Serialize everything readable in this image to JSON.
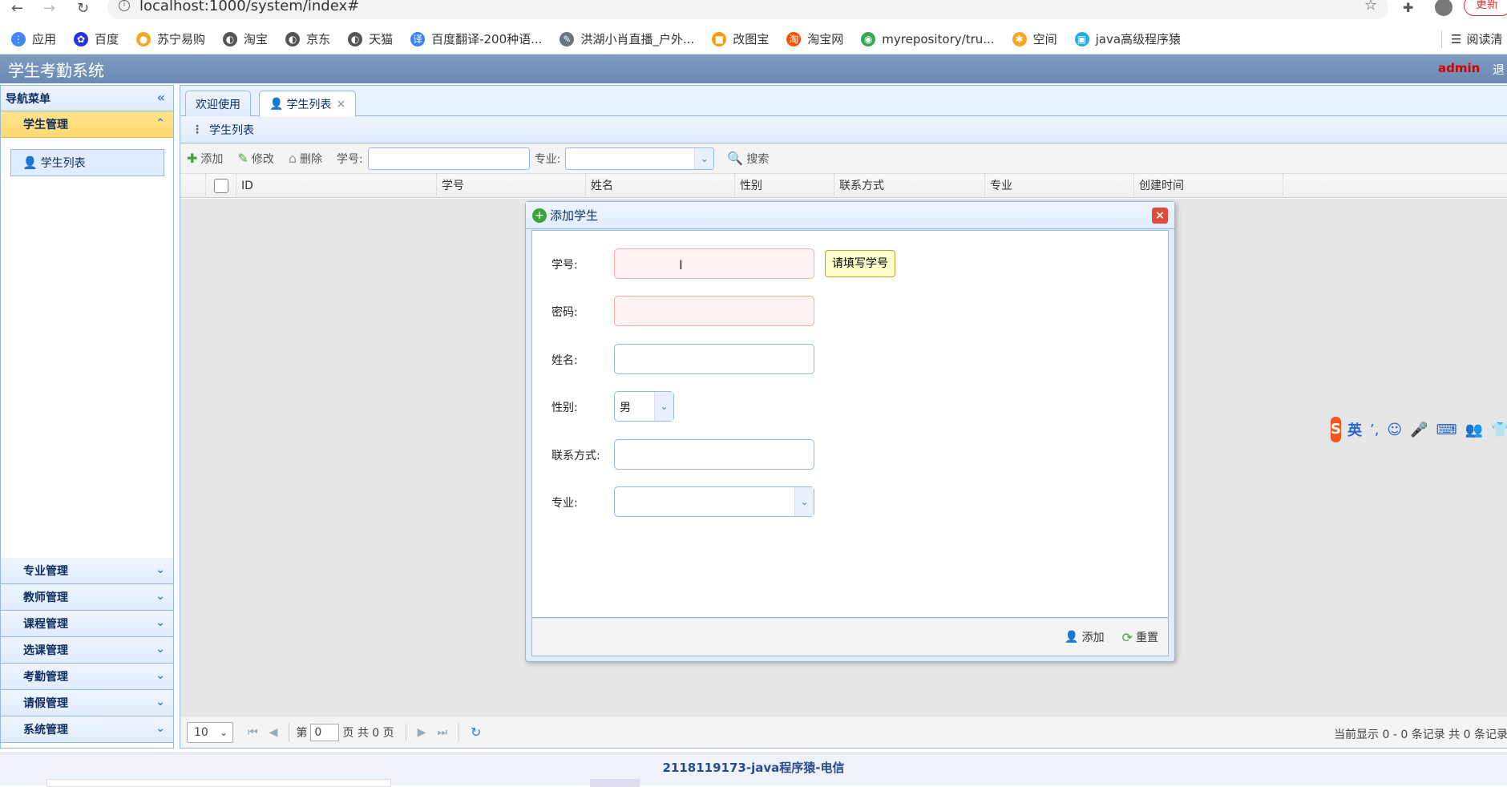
{
  "browser": {
    "url": "localhost:1000/system/index#",
    "update_label": "更新",
    "reading_mode": "阅读清",
    "bookmarks": [
      {
        "label": "应用",
        "icon": "apps-icon",
        "color": "#4285f4"
      },
      {
        "label": "百度",
        "icon": "baidu-icon",
        "color": "#2932e1"
      },
      {
        "label": "苏宁易购",
        "icon": "suning-icon",
        "color": "#f5a623"
      },
      {
        "label": "淘宝",
        "icon": "globe-icon",
        "color": "#555555"
      },
      {
        "label": "京东",
        "icon": "globe-icon",
        "color": "#555555"
      },
      {
        "label": "天猫",
        "icon": "globe-icon",
        "color": "#555555"
      },
      {
        "label": "百度翻译-200种语...",
        "icon": "translate-icon",
        "color": "#3b82f6"
      },
      {
        "label": "洪湖小肖直播_户外...",
        "icon": "feather-icon",
        "color": "#6b7280"
      },
      {
        "label": "改图宝",
        "icon": "gaitubao-icon",
        "color": "#f59e0b"
      },
      {
        "label": "淘宝网",
        "icon": "taobao-icon",
        "color": "#ff5000"
      },
      {
        "label": "myrepository/tru...",
        "icon": "chrome-icon",
        "color": "#34a853"
      },
      {
        "label": "空间",
        "icon": "qzone-icon",
        "color": "#f5a623"
      },
      {
        "label": "java高级程序猿",
        "icon": "bilibili-icon",
        "color": "#23ade5"
      }
    ]
  },
  "app": {
    "title": "学生考勤系统",
    "user": "admin",
    "logout": "退"
  },
  "nav": {
    "header": "导航菜单",
    "active_group": "学生管理",
    "active_item": "学生列表",
    "groups": [
      "专业管理",
      "教师管理",
      "课程管理",
      "选课管理",
      "考勤管理",
      "请假管理",
      "系统管理"
    ]
  },
  "tabs": [
    {
      "label": "欢迎使用"
    },
    {
      "label": "学生列表",
      "close": "×"
    }
  ],
  "panel": {
    "title": "学生列表"
  },
  "toolbar": {
    "add": "添加",
    "edit": "修改",
    "delete": "删除",
    "sn_label": "学号:",
    "major_label": "专业:",
    "search": "搜索"
  },
  "grid": {
    "columns": [
      "ID",
      "学号",
      "姓名",
      "性别",
      "联系方式",
      "专业",
      "创建时间"
    ]
  },
  "pager": {
    "page_size": "10",
    "page_prefix": "第",
    "page_value": "0",
    "page_suffix": "页 共 0 页",
    "summary": "当前显示 0 - 0 条记录 共 0 条记录"
  },
  "dialog": {
    "title": "添加学生",
    "close": "×",
    "fields": [
      {
        "label": "学号:",
        "value": "",
        "state": "invalid"
      },
      {
        "label": "密码:",
        "value": "",
        "state": "invalid"
      },
      {
        "label": "姓名:",
        "value": ""
      },
      {
        "label": "性别:",
        "value": "男"
      },
      {
        "label": "联系方式:",
        "value": ""
      },
      {
        "label": "专业:",
        "value": ""
      }
    ],
    "tooltip": "请填写学号",
    "add_button": "添加",
    "reset_button": "重置"
  },
  "footer": {
    "text": "2118119173-java程序猿-电信"
  },
  "ime": {
    "lang": "英"
  }
}
